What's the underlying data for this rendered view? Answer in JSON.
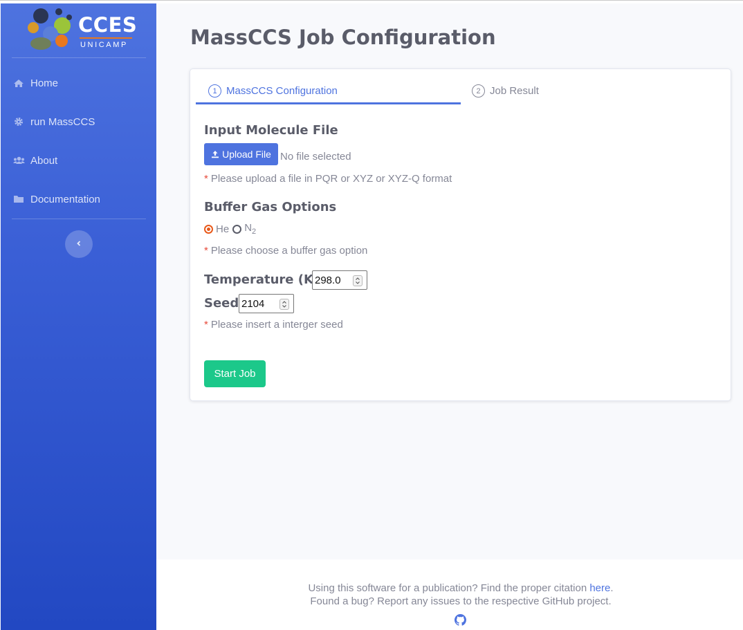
{
  "brand": {
    "title": "CCES",
    "subtitle": "UNICAMP"
  },
  "sidebar": {
    "items": [
      {
        "label": "Home",
        "icon": "home-icon"
      },
      {
        "label": "run MassCCS",
        "icon": "gear-icon"
      },
      {
        "label": "About",
        "icon": "users-icon"
      },
      {
        "label": "Documentation",
        "icon": "folder-icon"
      }
    ],
    "toggle_icon": "chevron-left-icon"
  },
  "page": {
    "title": "MassCCS Job Configuration"
  },
  "steps": [
    {
      "number": "1",
      "label": "MassCCS Configuration",
      "active": true
    },
    {
      "number": "2",
      "label": "Job Result",
      "active": false
    }
  ],
  "form": {
    "molecule": {
      "title": "Input Molecule File",
      "upload_label": "Upload File",
      "file_status": "No file selected",
      "hint": "Please upload a file in PQR or XYZ or XYZ-Q format"
    },
    "buffer_gas": {
      "title": "Buffer Gas Options",
      "options": [
        {
          "label": "He",
          "checked": true
        },
        {
          "label": "N",
          "subscript": "2",
          "checked": false
        }
      ],
      "hint": "Please choose a buffer gas option"
    },
    "temperature": {
      "label": "Temperature (K)",
      "value": "298.0"
    },
    "seed": {
      "label": "Seed",
      "value": "2104",
      "hint": "Please insert a interger seed"
    },
    "required_marker": "*",
    "submit_label": "Start Job"
  },
  "footer": {
    "citation_text": "Using this software for a publication? Find the proper citation",
    "citation_link": "here",
    "citation_end": ".",
    "bug_text": "Found a bug? Report any issues to the respective GitHub project.",
    "github_icon": "github-icon"
  },
  "colors": {
    "sidebar_top": "#4e73df",
    "sidebar_bottom": "#2248c2",
    "primary": "#4e73df",
    "success": "#1cc88a",
    "required": "#e74a3b",
    "radio_accent": "#e8591a"
  }
}
